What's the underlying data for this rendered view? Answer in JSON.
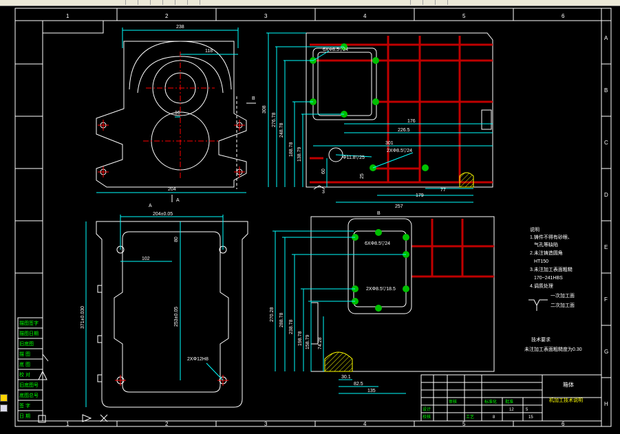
{
  "frame": {
    "col_labels": [
      "1",
      "2",
      "3",
      "4",
      "5",
      "6"
    ],
    "row_labels": [
      "A",
      "B",
      "C",
      "D",
      "E",
      "F",
      "G",
      "H"
    ]
  },
  "views": {
    "top_left": {
      "dim_width": "238",
      "dim_118": "118",
      "dim_16": "16",
      "dim_204": "204",
      "section_mark": "A",
      "arrow_mark": "A",
      "b_mark": "B"
    },
    "top_right": {
      "note_holes_1": "6XΦ8.5▽24",
      "note_hole_11": "Φ11.8▽25",
      "note_holes_2": "2XΦ8.5▽24",
      "v_dims": [
        "308",
        "276.78",
        "248.78",
        "188.78",
        "138.79",
        "60"
      ],
      "h_dims": [
        "176",
        "226.5",
        "301",
        "257",
        "179",
        "77"
      ],
      "dim_25": "25",
      "section_3": "3"
    },
    "bottom_left": {
      "dim_top": "204±0.05",
      "dim_80": "80",
      "dim_102": "102",
      "dim_v_left": "371±0.030",
      "dim_v_mid": "253±0.05",
      "note": "2XΦ12H8"
    },
    "bottom_right": {
      "b_mark": "B",
      "note_holes_1": "6XΦ8.5▽24",
      "note_holes_2": "2XΦ8.5▽18.5",
      "v_dims": [
        "270.28",
        "288.78",
        "238.78",
        "198.78",
        "158.79",
        "74.28"
      ],
      "h_dims": [
        "30.1",
        "82.5",
        "135"
      ]
    }
  },
  "notes": {
    "title": "说明",
    "items": [
      "1.铸件不得有砂眼、",
      "气孔等缺陷",
      "2.未注铸造圆角",
      "HT150",
      "3.未注加工表面粗糙",
      "170~241HBS",
      "4.调质处理"
    ],
    "legend_1": "一次加工面",
    "legend_2": "二次加工面",
    "req_title": "技术要求",
    "req_text": "未注加工表面粗糙度为0.30"
  },
  "title_block": {
    "name": "箱体",
    "subtitle": "机加工技术说明",
    "small_cells": [
      "设计",
      "校核",
      "审核",
      "工艺",
      "标准化",
      "批准"
    ],
    "scale_row": [
      "8",
      "12",
      "5",
      "15"
    ]
  },
  "left_table": {
    "rows": [
      "描图签字",
      "描图日期",
      "旧底图",
      "描 图",
      "底 图",
      "校 对",
      "旧底图号",
      "底图总号",
      "签 字",
      "日 期"
    ]
  },
  "colors": {
    "white": "#ffffff",
    "cyan": "#00ffff",
    "green": "#00ff00",
    "red": "#ff0000",
    "darkred": "#c00000",
    "yellow": "#ffff00"
  }
}
